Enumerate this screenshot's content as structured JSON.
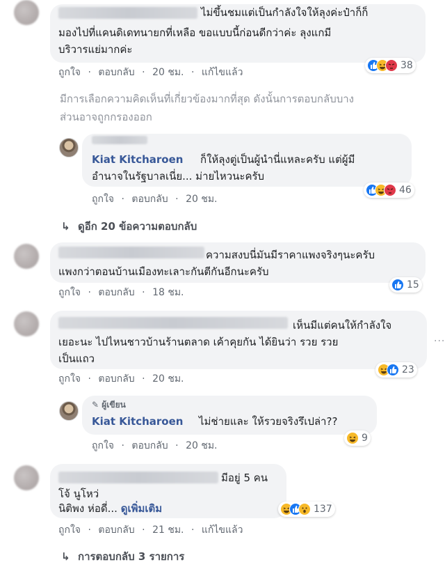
{
  "actions": {
    "like": "ถูกใจ",
    "reply": "ตอบกลับ",
    "edited": "แก้ไขแล้ว",
    "sep": "·"
  },
  "comments": [
    {
      "lines": [
        "ไม่ขึ้นชมแต่เป็นกำลังใจให้ลุงค่ะป๋าก็ก็",
        "มองไปที่แคนดิเดทนายกที่เหลือ ขอแบบนี้ก่อนดีกว่าค่ะ ลุงแกมี",
        "บริวารแย่มากค่ะ"
      ],
      "time": "20 ชม.",
      "reactions": "38",
      "reaction_icons": [
        "like-icon",
        "haha-icon",
        "angry-icon"
      ]
    },
    {
      "lines": [
        "ความสงบนี่มันมีราคาแพงจริงๆนะครับ",
        "แพงกว่าตอนบ้านเมืองทะเลาะกันตีกันอีกนะครับ"
      ],
      "time": "18 ชม.",
      "reactions": "15",
      "reaction_icons": [
        "like-icon"
      ]
    },
    {
      "lines": [
        "เห็นมีแต่คนให้กำลังใจ",
        "เยอะนะ ไปไหนชาวบ้านร้านตลาด เค้าคุยกัน ได้ยินว่า รวย รวย",
        "เป็นแถว"
      ],
      "time": "20 ชม.",
      "reactions": "23",
      "reaction_icons": [
        "haha-icon",
        "like-icon"
      ]
    },
    {
      "lines": [
        "มีอยู่ 5 คน",
        "โจ้ นูโหว่",
        "นิติพง ห่อดี่..."
      ],
      "see_more": "ดูเพิ่มเติม",
      "time": "21 ชม.",
      "reactions": "137",
      "reaction_icons": [
        "haha-icon",
        "like-icon",
        "wow-icon"
      ]
    }
  ],
  "notice": [
    "มีการเลือกความคิดเห็นที่เกี่ยวข้องมากที่สุด ดังนั้นการตอบกลับบาง",
    "ส่วนอาจถูกกรองออก"
  ],
  "replies": [
    {
      "name": "Kiat Kitcharoen",
      "line1": "ก็ให้ลุงตู่เป็นผู้นำนี่แหละครับ แต่ผู้มี",
      "line2": "อำนาจในรัฐบาลเนี่ย... ม่ายไหวนะครับ",
      "time": "20 ชม.",
      "reactions": "46",
      "reaction_icons": [
        "like-icon",
        "haha-icon",
        "angry-icon"
      ]
    },
    {
      "author_tag": "ผู้เขียน",
      "name": "Kiat Kitcharoen",
      "text": "ไม่ช่ายและ ให้รวยจริงรึเปล่า??",
      "time": "20 ชม.",
      "reactions": "9",
      "reaction_icons": [
        "haha-icon"
      ]
    }
  ],
  "more_replies": "ดูอีก 20 ข้อความตอบกลับ",
  "reply_count": "การตอบกลับ 3 รายการ",
  "colors": {
    "bubble": "#f2f3f5",
    "name": "#385898",
    "like": "#1877f2",
    "haha": "#f7b928",
    "angry": "#e0394a"
  }
}
